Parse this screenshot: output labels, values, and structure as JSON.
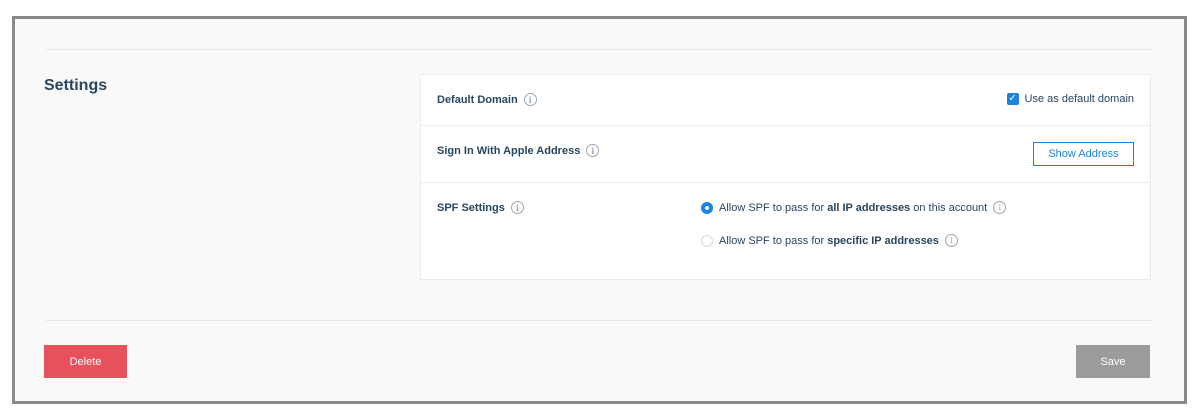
{
  "settings": {
    "title": "Settings",
    "default_domain": {
      "label": "Default Domain",
      "checkbox_label": "Use as default domain",
      "checked": true
    },
    "apple": {
      "label": "Sign In With Apple Address",
      "button": "Show Address"
    },
    "spf": {
      "label": "SPF Settings",
      "option1": {
        "prefix": "Allow SPF to pass for ",
        "bold": "all IP addresses",
        "suffix": " on this account",
        "selected": true
      },
      "option2": {
        "prefix": "Allow SPF to pass for ",
        "bold": "specific IP addresses",
        "suffix": "",
        "selected": false
      }
    }
  },
  "footer": {
    "delete": "Delete",
    "save": "Save"
  },
  "colors": {
    "accent": "#1a82e2",
    "danger": "#e8505b",
    "disabled": "#9b9b9b",
    "text": "#294661"
  },
  "icons": {
    "info": "info-icon",
    "check": "checkmark-icon"
  }
}
